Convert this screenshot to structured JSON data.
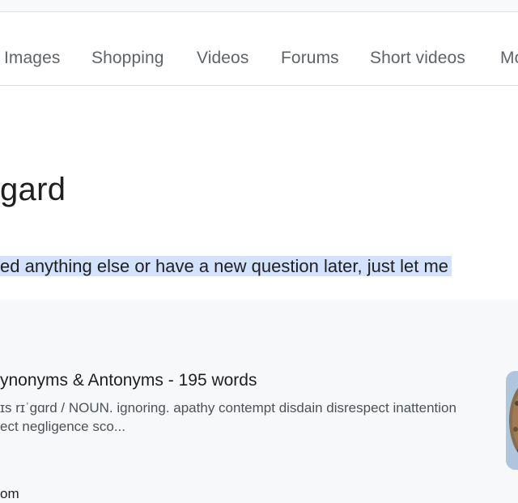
{
  "tabs": [
    {
      "label": "Images"
    },
    {
      "label": "Shopping"
    },
    {
      "label": "Videos"
    },
    {
      "label": "Forums"
    },
    {
      "label": "Short videos"
    },
    {
      "label": "Mo"
    }
  ],
  "heading": "gard",
  "answer": {
    "text": "ed anything else or have a new question later, just let me"
  },
  "result": {
    "title": "ynonyms & Antonyms - 195 words",
    "snippet_line1": "ɪs rɪˈgɑrd / NOUN. ignoring. apathy contempt disdain disrespect inattention",
    "snippet_line2": "ect negligence sco...",
    "site": "om",
    "thumbnail_icon": "thumbnail-image"
  },
  "colors": {
    "highlight": "#d3e3fd",
    "tab_text": "#5f6368",
    "card_bg": "#f7f8fa"
  }
}
